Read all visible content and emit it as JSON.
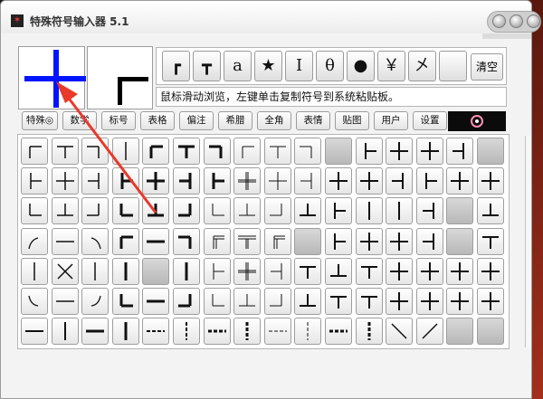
{
  "window": {
    "title": "特殊符号输入器 5.1"
  },
  "preview": {
    "large_symbol": "┼",
    "small_symbol": "┏"
  },
  "quick_symbols": [
    "┏",
    "┳",
    "a",
    "★",
    "Ⅰ",
    "θ",
    "●",
    "￥",
    "㐅",
    ""
  ],
  "clear_label": "清空",
  "hint_text": "鼠标滑动浏览，左键单击复制符号到系统粘贴板。",
  "tabs": [
    "特殊◎",
    "数学",
    "标号",
    "表格",
    "偏注",
    "希腊",
    "全角",
    "表情",
    "贴图",
    "用户",
    "设置"
  ],
  "annotation": {
    "arrow_color": "#e8392b"
  },
  "colors": {
    "preview_symbol": "#0015ff",
    "annotation_arrow": "#e8392b"
  }
}
